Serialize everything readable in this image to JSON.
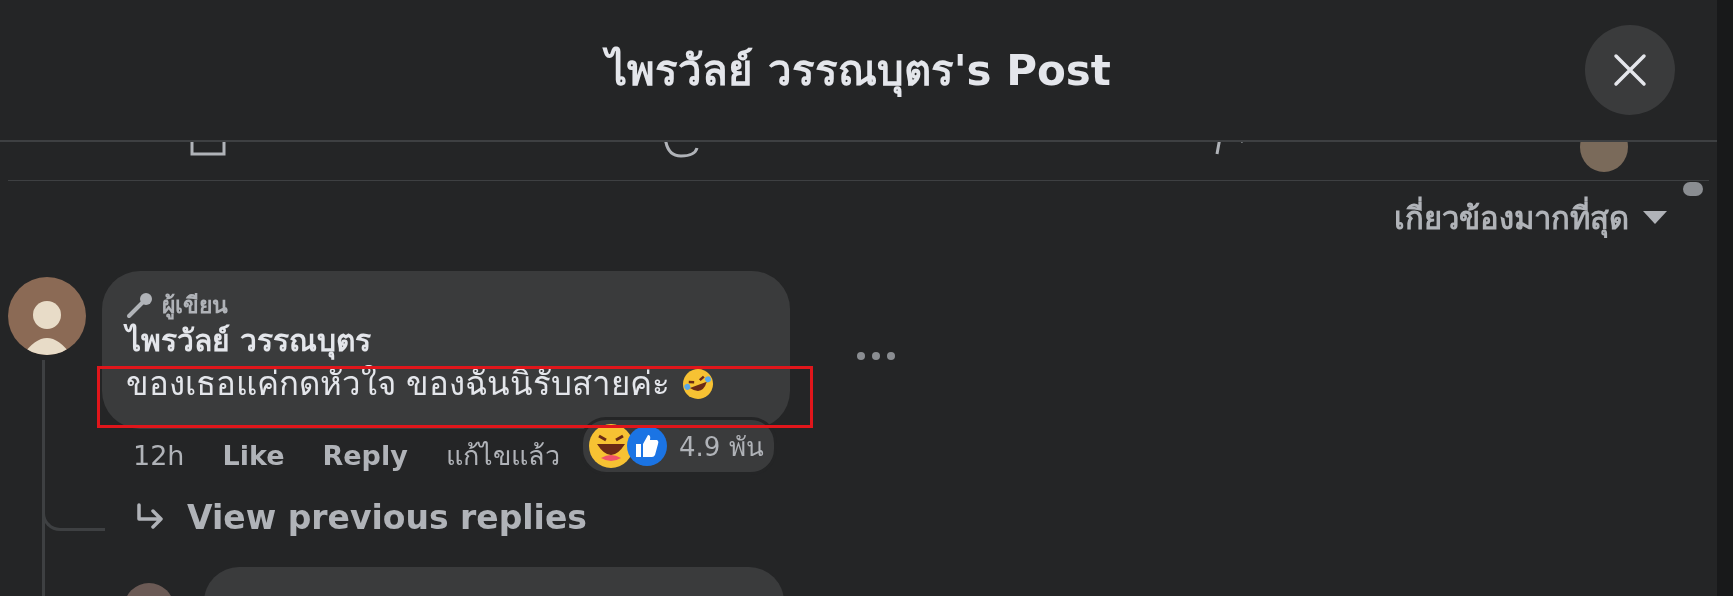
{
  "header": {
    "title": "ไพรวัลย์ วรรณบุตร's Post"
  },
  "sort": {
    "label": "เกี่ยวข้องมากที่สุด"
  },
  "comment": {
    "badge": "ผู้เขียน",
    "author": "ไพรวัลย์ วรรณบุตร",
    "text": "ของเธอแค่กดหัวใจ ของฉันนิรับสายค่ะ",
    "highlighted": true,
    "reaction_count": "4.9 พัน",
    "time": "12h",
    "actions": [
      "Like",
      "Reply"
    ],
    "edited": "แก้ไขแล้ว"
  },
  "view_replies": {
    "label": "View previous replies"
  }
}
